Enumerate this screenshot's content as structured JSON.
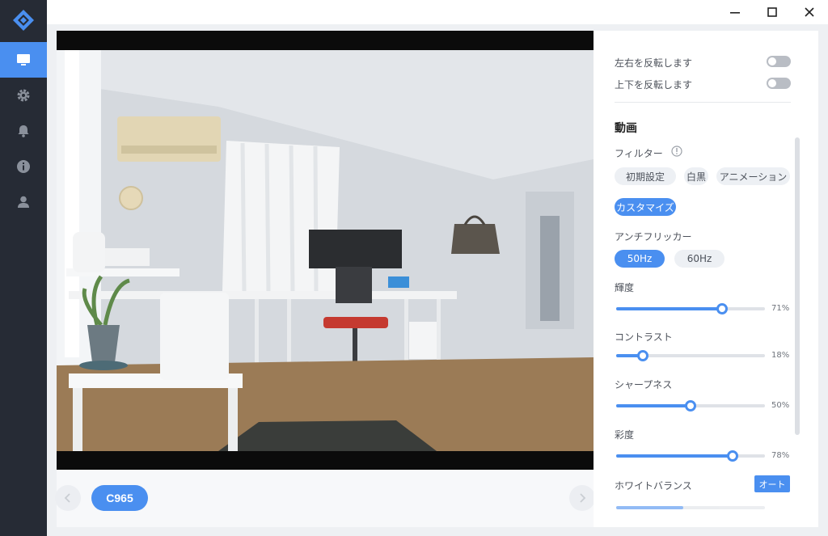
{
  "sidebar": {
    "logo": "diamond-logo-icon",
    "items": [
      {
        "icon": "monitor-icon",
        "active": true
      },
      {
        "icon": "gear-icon",
        "active": false
      },
      {
        "icon": "bell-icon",
        "active": false
      },
      {
        "icon": "info-icon",
        "active": false
      },
      {
        "icon": "user-icon",
        "active": false
      }
    ]
  },
  "window_controls": [
    "minimize-icon",
    "maximize-icon",
    "close-icon"
  ],
  "preview": {
    "camera_label": "C965"
  },
  "settings": {
    "flip_horizontal_label": "左右を反転します",
    "flip_vertical_label": "上下を反転します",
    "video_section_title": "動画",
    "filter": {
      "label": "フィルター",
      "options": [
        "初期設定",
        "白黒",
        "アニメーション",
        "カスタマイズ"
      ],
      "selected": "カスタマイズ"
    },
    "antiflicker": {
      "label": "アンチフリッカー",
      "options": [
        "50Hz",
        "60Hz"
      ],
      "selected": "50Hz"
    },
    "sliders": [
      {
        "label": "輝度",
        "value": 71,
        "display": "71%"
      },
      {
        "label": "コントラスト",
        "value": 18,
        "display": "18%"
      },
      {
        "label": "シャープネス",
        "value": 50,
        "display": "50%"
      },
      {
        "label": "彩度",
        "value": 78,
        "display": "78%"
      }
    ],
    "white_balance": {
      "label": "ホワイトバランス",
      "auto_label": "オート"
    }
  },
  "colors": {
    "accent": "#4a8ff0",
    "sidebar_bg": "#262b35"
  }
}
